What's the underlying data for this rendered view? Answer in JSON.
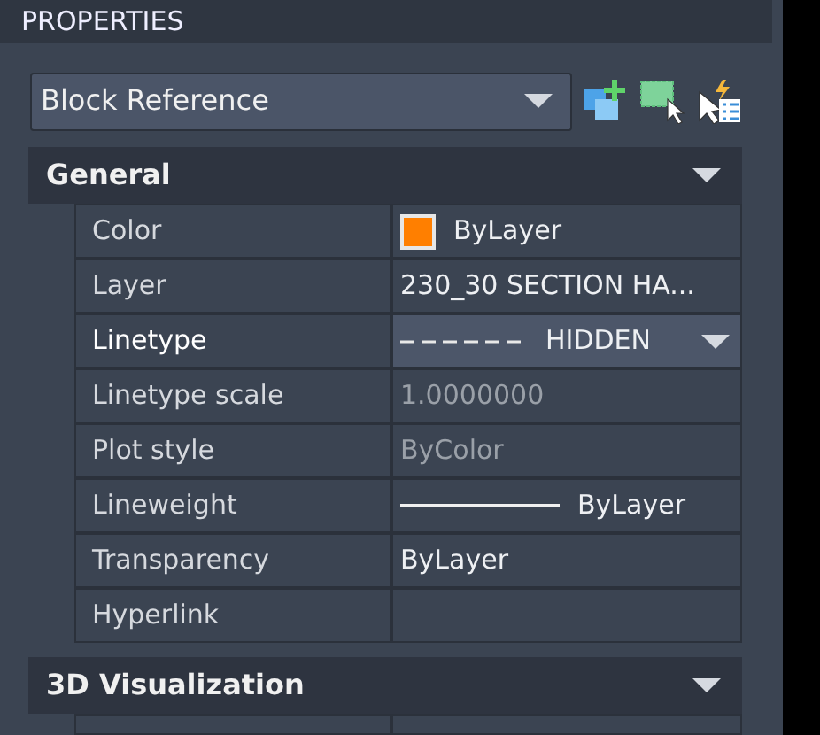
{
  "panel_title": "PROPERTIES",
  "object_type": {
    "value": "Block Reference"
  },
  "sections": [
    {
      "title": "General",
      "expanded": true,
      "rows": [
        {
          "label": "Color",
          "value": "ByLayer",
          "kind": "color",
          "color": "#ff7f00",
          "selected": false,
          "disabled": false
        },
        {
          "label": "Layer",
          "value": "230_30 SECTION HA...",
          "kind": "text",
          "selected": false,
          "disabled": false
        },
        {
          "label": "Linetype",
          "value": "HIDDEN",
          "kind": "linetype",
          "selected": true,
          "disabled": false
        },
        {
          "label": "Linetype scale",
          "value": "1.0000000",
          "kind": "text",
          "selected": false,
          "disabled": true
        },
        {
          "label": "Plot style",
          "value": "ByColor",
          "kind": "text",
          "selected": false,
          "disabled": true
        },
        {
          "label": "Lineweight",
          "value": "ByLayer",
          "kind": "lineweight",
          "selected": false,
          "disabled": false
        },
        {
          "label": "Transparency",
          "value": "ByLayer",
          "kind": "text",
          "selected": false,
          "disabled": false
        },
        {
          "label": "Hyperlink",
          "kind": "text",
          "selected": false,
          "disabled": false
        }
      ]
    },
    {
      "title": "3D Visualization",
      "expanded": true
    }
  ]
}
